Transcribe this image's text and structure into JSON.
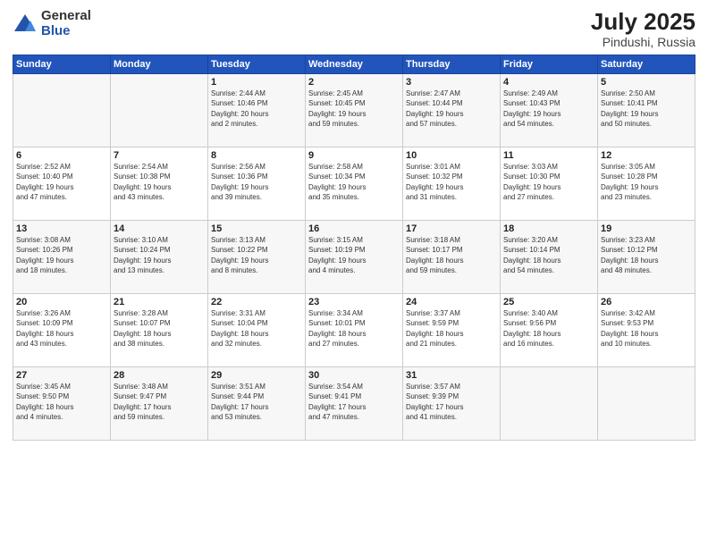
{
  "logo": {
    "general": "General",
    "blue": "Blue"
  },
  "title": "July 2025",
  "location": "Pindushi, Russia",
  "days_header": [
    "Sunday",
    "Monday",
    "Tuesday",
    "Wednesday",
    "Thursday",
    "Friday",
    "Saturday"
  ],
  "weeks": [
    [
      {
        "num": "",
        "info": ""
      },
      {
        "num": "",
        "info": ""
      },
      {
        "num": "1",
        "info": "Sunrise: 2:44 AM\nSunset: 10:46 PM\nDaylight: 20 hours\nand 2 minutes."
      },
      {
        "num": "2",
        "info": "Sunrise: 2:45 AM\nSunset: 10:45 PM\nDaylight: 19 hours\nand 59 minutes."
      },
      {
        "num": "3",
        "info": "Sunrise: 2:47 AM\nSunset: 10:44 PM\nDaylight: 19 hours\nand 57 minutes."
      },
      {
        "num": "4",
        "info": "Sunrise: 2:49 AM\nSunset: 10:43 PM\nDaylight: 19 hours\nand 54 minutes."
      },
      {
        "num": "5",
        "info": "Sunrise: 2:50 AM\nSunset: 10:41 PM\nDaylight: 19 hours\nand 50 minutes."
      }
    ],
    [
      {
        "num": "6",
        "info": "Sunrise: 2:52 AM\nSunset: 10:40 PM\nDaylight: 19 hours\nand 47 minutes."
      },
      {
        "num": "7",
        "info": "Sunrise: 2:54 AM\nSunset: 10:38 PM\nDaylight: 19 hours\nand 43 minutes."
      },
      {
        "num": "8",
        "info": "Sunrise: 2:56 AM\nSunset: 10:36 PM\nDaylight: 19 hours\nand 39 minutes."
      },
      {
        "num": "9",
        "info": "Sunrise: 2:58 AM\nSunset: 10:34 PM\nDaylight: 19 hours\nand 35 minutes."
      },
      {
        "num": "10",
        "info": "Sunrise: 3:01 AM\nSunset: 10:32 PM\nDaylight: 19 hours\nand 31 minutes."
      },
      {
        "num": "11",
        "info": "Sunrise: 3:03 AM\nSunset: 10:30 PM\nDaylight: 19 hours\nand 27 minutes."
      },
      {
        "num": "12",
        "info": "Sunrise: 3:05 AM\nSunset: 10:28 PM\nDaylight: 19 hours\nand 23 minutes."
      }
    ],
    [
      {
        "num": "13",
        "info": "Sunrise: 3:08 AM\nSunset: 10:26 PM\nDaylight: 19 hours\nand 18 minutes."
      },
      {
        "num": "14",
        "info": "Sunrise: 3:10 AM\nSunset: 10:24 PM\nDaylight: 19 hours\nand 13 minutes."
      },
      {
        "num": "15",
        "info": "Sunrise: 3:13 AM\nSunset: 10:22 PM\nDaylight: 19 hours\nand 8 minutes."
      },
      {
        "num": "16",
        "info": "Sunrise: 3:15 AM\nSunset: 10:19 PM\nDaylight: 19 hours\nand 4 minutes."
      },
      {
        "num": "17",
        "info": "Sunrise: 3:18 AM\nSunset: 10:17 PM\nDaylight: 18 hours\nand 59 minutes."
      },
      {
        "num": "18",
        "info": "Sunrise: 3:20 AM\nSunset: 10:14 PM\nDaylight: 18 hours\nand 54 minutes."
      },
      {
        "num": "19",
        "info": "Sunrise: 3:23 AM\nSunset: 10:12 PM\nDaylight: 18 hours\nand 48 minutes."
      }
    ],
    [
      {
        "num": "20",
        "info": "Sunrise: 3:26 AM\nSunset: 10:09 PM\nDaylight: 18 hours\nand 43 minutes."
      },
      {
        "num": "21",
        "info": "Sunrise: 3:28 AM\nSunset: 10:07 PM\nDaylight: 18 hours\nand 38 minutes."
      },
      {
        "num": "22",
        "info": "Sunrise: 3:31 AM\nSunset: 10:04 PM\nDaylight: 18 hours\nand 32 minutes."
      },
      {
        "num": "23",
        "info": "Sunrise: 3:34 AM\nSunset: 10:01 PM\nDaylight: 18 hours\nand 27 minutes."
      },
      {
        "num": "24",
        "info": "Sunrise: 3:37 AM\nSunset: 9:59 PM\nDaylight: 18 hours\nand 21 minutes."
      },
      {
        "num": "25",
        "info": "Sunrise: 3:40 AM\nSunset: 9:56 PM\nDaylight: 18 hours\nand 16 minutes."
      },
      {
        "num": "26",
        "info": "Sunrise: 3:42 AM\nSunset: 9:53 PM\nDaylight: 18 hours\nand 10 minutes."
      }
    ],
    [
      {
        "num": "27",
        "info": "Sunrise: 3:45 AM\nSunset: 9:50 PM\nDaylight: 18 hours\nand 4 minutes."
      },
      {
        "num": "28",
        "info": "Sunrise: 3:48 AM\nSunset: 9:47 PM\nDaylight: 17 hours\nand 59 minutes."
      },
      {
        "num": "29",
        "info": "Sunrise: 3:51 AM\nSunset: 9:44 PM\nDaylight: 17 hours\nand 53 minutes."
      },
      {
        "num": "30",
        "info": "Sunrise: 3:54 AM\nSunset: 9:41 PM\nDaylight: 17 hours\nand 47 minutes."
      },
      {
        "num": "31",
        "info": "Sunrise: 3:57 AM\nSunset: 9:39 PM\nDaylight: 17 hours\nand 41 minutes."
      },
      {
        "num": "",
        "info": ""
      },
      {
        "num": "",
        "info": ""
      }
    ]
  ]
}
